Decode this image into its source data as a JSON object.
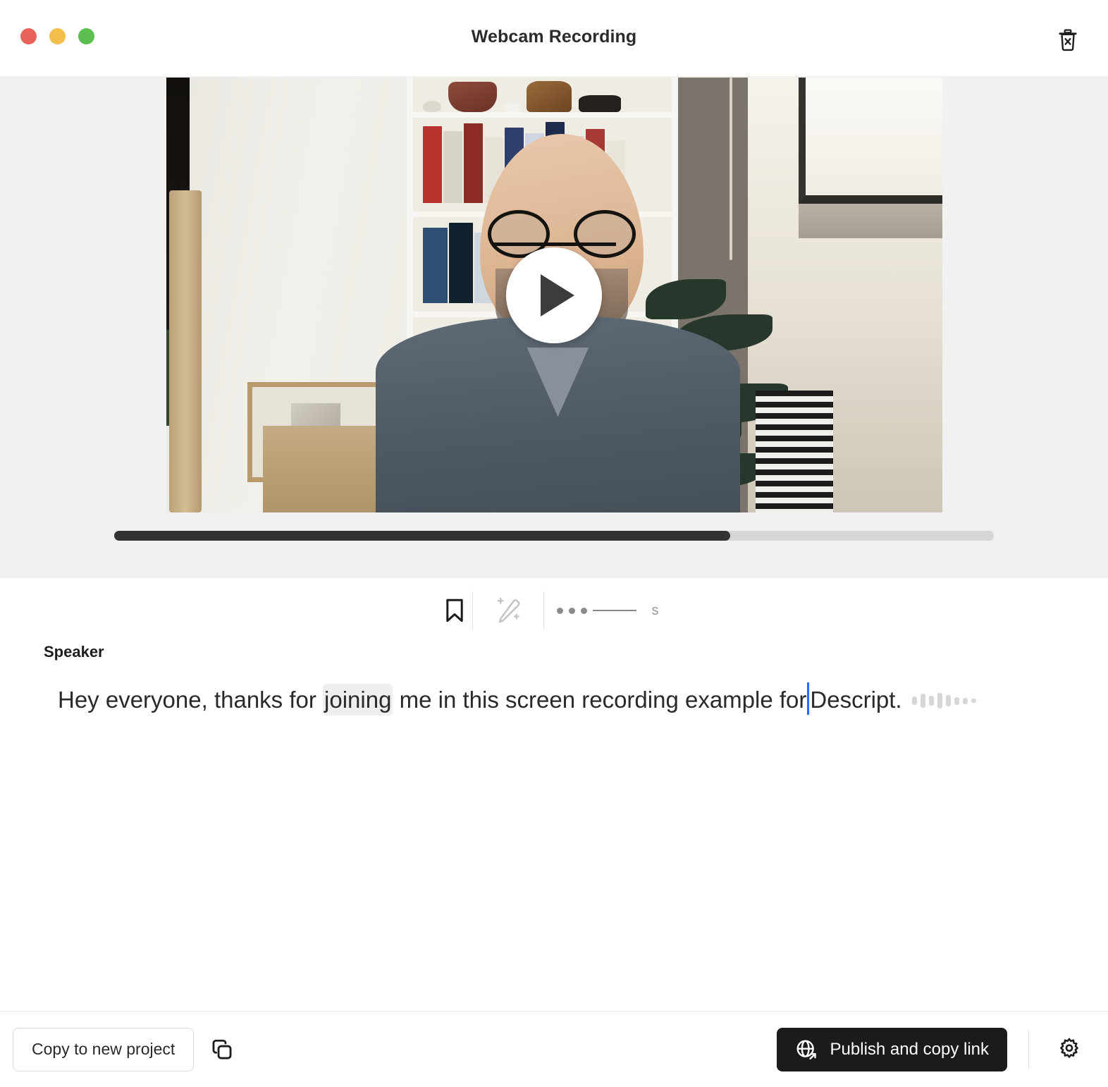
{
  "window": {
    "title": "Webcam Recording",
    "traffic_lights": [
      {
        "name": "close",
        "color": "#e8635a"
      },
      {
        "name": "minimize",
        "color": "#f2be4c"
      },
      {
        "name": "maximize",
        "color": "#5cbf50"
      }
    ],
    "delete_icon": "trash-x-icon"
  },
  "player": {
    "play_icon": "play-icon",
    "progress_percent": 70,
    "scrubber_filled_color": "#333333",
    "scrubber_track_color": "#d6d6d6",
    "panel_background": "#f1f1f1"
  },
  "transcript_toolbar": {
    "bookmark_icon": "bookmark-icon",
    "magic_edit_icon": "magic-pencil-icon",
    "gap_icon": "audio-gap-icon",
    "gap_label": "s"
  },
  "transcript": {
    "speaker_label": "Speaker",
    "text_before_highlight": "Hey everyone, thanks for ",
    "highlighted_word": "joining",
    "text_after_highlight": " me in this screen recording example for",
    "text_after_caret": "Descript.",
    "caret_color": "#2b6cf6",
    "highlight_color": "#efefef",
    "audio_gap_indicator": "audio-waveform-gap"
  },
  "bottom_bar": {
    "copy_to_new_project_label": "Copy to new project",
    "copy_icon": "copy-icon",
    "publish_label": "Publish and copy link",
    "publish_icon": "globe-share-icon",
    "publish_background": "#1b1b1b",
    "settings_icon": "gear-icon"
  }
}
